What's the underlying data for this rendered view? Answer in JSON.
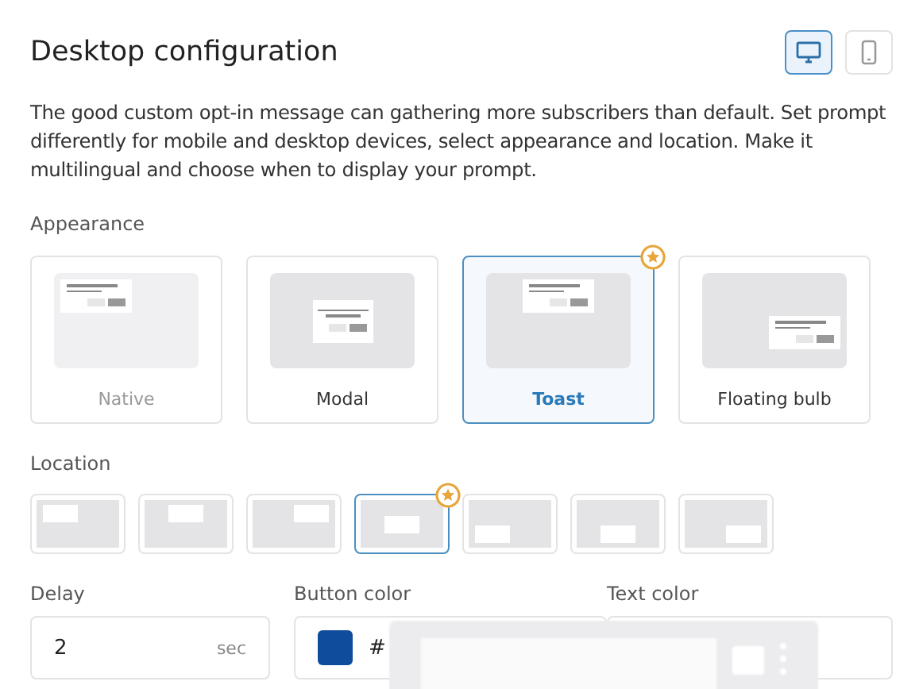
{
  "header": {
    "title": "Desktop configuration",
    "devices": [
      {
        "kind": "desktop",
        "selected": true
      },
      {
        "kind": "mobile",
        "selected": false
      }
    ]
  },
  "description": "The good custom opt-in message can gathering more subscribers than default. Set prompt differently for mobile and desktop devices, select appearance and location. Make it multilingual and choose when to display your prompt.",
  "appearance": {
    "label": "Appearance",
    "options": [
      {
        "kind": "native",
        "label": "Native",
        "selected": false,
        "disabled": true,
        "recommended": false
      },
      {
        "kind": "modal",
        "label": "Modal",
        "selected": false,
        "disabled": false,
        "recommended": false
      },
      {
        "kind": "toast",
        "label": "Toast",
        "selected": true,
        "disabled": false,
        "recommended": true
      },
      {
        "kind": "bulb",
        "label": "Floating bulb",
        "selected": false,
        "disabled": false,
        "recommended": false
      }
    ]
  },
  "location": {
    "label": "Location",
    "options": [
      {
        "kind": "top-left",
        "selected": false,
        "recommended": false
      },
      {
        "kind": "top-center",
        "selected": false,
        "recommended": false
      },
      {
        "kind": "top-right",
        "selected": false,
        "recommended": false
      },
      {
        "kind": "center",
        "selected": true,
        "recommended": true
      },
      {
        "kind": "bottom-left",
        "selected": false,
        "recommended": false
      },
      {
        "kind": "bottom-center",
        "selected": false,
        "recommended": false
      },
      {
        "kind": "bottom-right",
        "selected": false,
        "recommended": false
      }
    ]
  },
  "delay": {
    "label": "Delay",
    "value": "2",
    "unit": "sec"
  },
  "button_color": {
    "label": "Button color",
    "color": "#0f4c9c",
    "value": "#"
  },
  "text_color": {
    "label": "Text color"
  }
}
